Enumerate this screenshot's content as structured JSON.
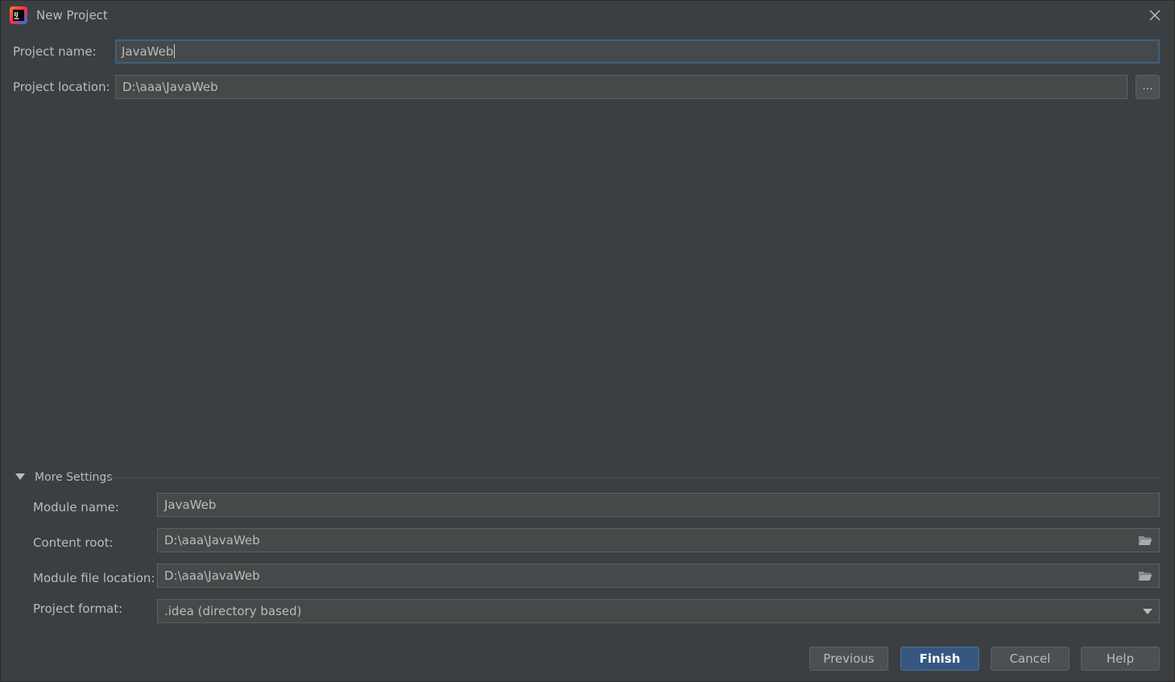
{
  "window": {
    "title": "New Project"
  },
  "project": {
    "name_label": "Project name:",
    "name_value": "JavaWeb",
    "location_label": "Project location:",
    "location_value": "D:\\aaa\\JavaWeb",
    "browse_label": "..."
  },
  "more_settings": {
    "title": "More Settings",
    "expanded": true,
    "module_name_label": "Module name:",
    "module_name_value": "JavaWeb",
    "content_root_label": "Content root:",
    "content_root_value": "D:\\aaa\\JavaWeb",
    "module_file_label": "Module file location:",
    "module_file_value": "D:\\aaa\\JavaWeb",
    "format_label": "Project format:",
    "format_value": ".idea (directory based)"
  },
  "buttons": {
    "previous": "Previous",
    "finish": "Finish",
    "cancel": "Cancel",
    "help": "Help"
  },
  "icons": {
    "app": "intellij-idea-icon",
    "close": "close-icon",
    "folder": "folder-icon",
    "expand": "triangle-down-icon",
    "dropdown": "chevron-down-icon"
  },
  "colors": {
    "background": "#3c3f41",
    "field_bg": "#45494a",
    "focus_border": "#3d6185",
    "primary_button": "#365880",
    "text": "#bbbbbb"
  }
}
